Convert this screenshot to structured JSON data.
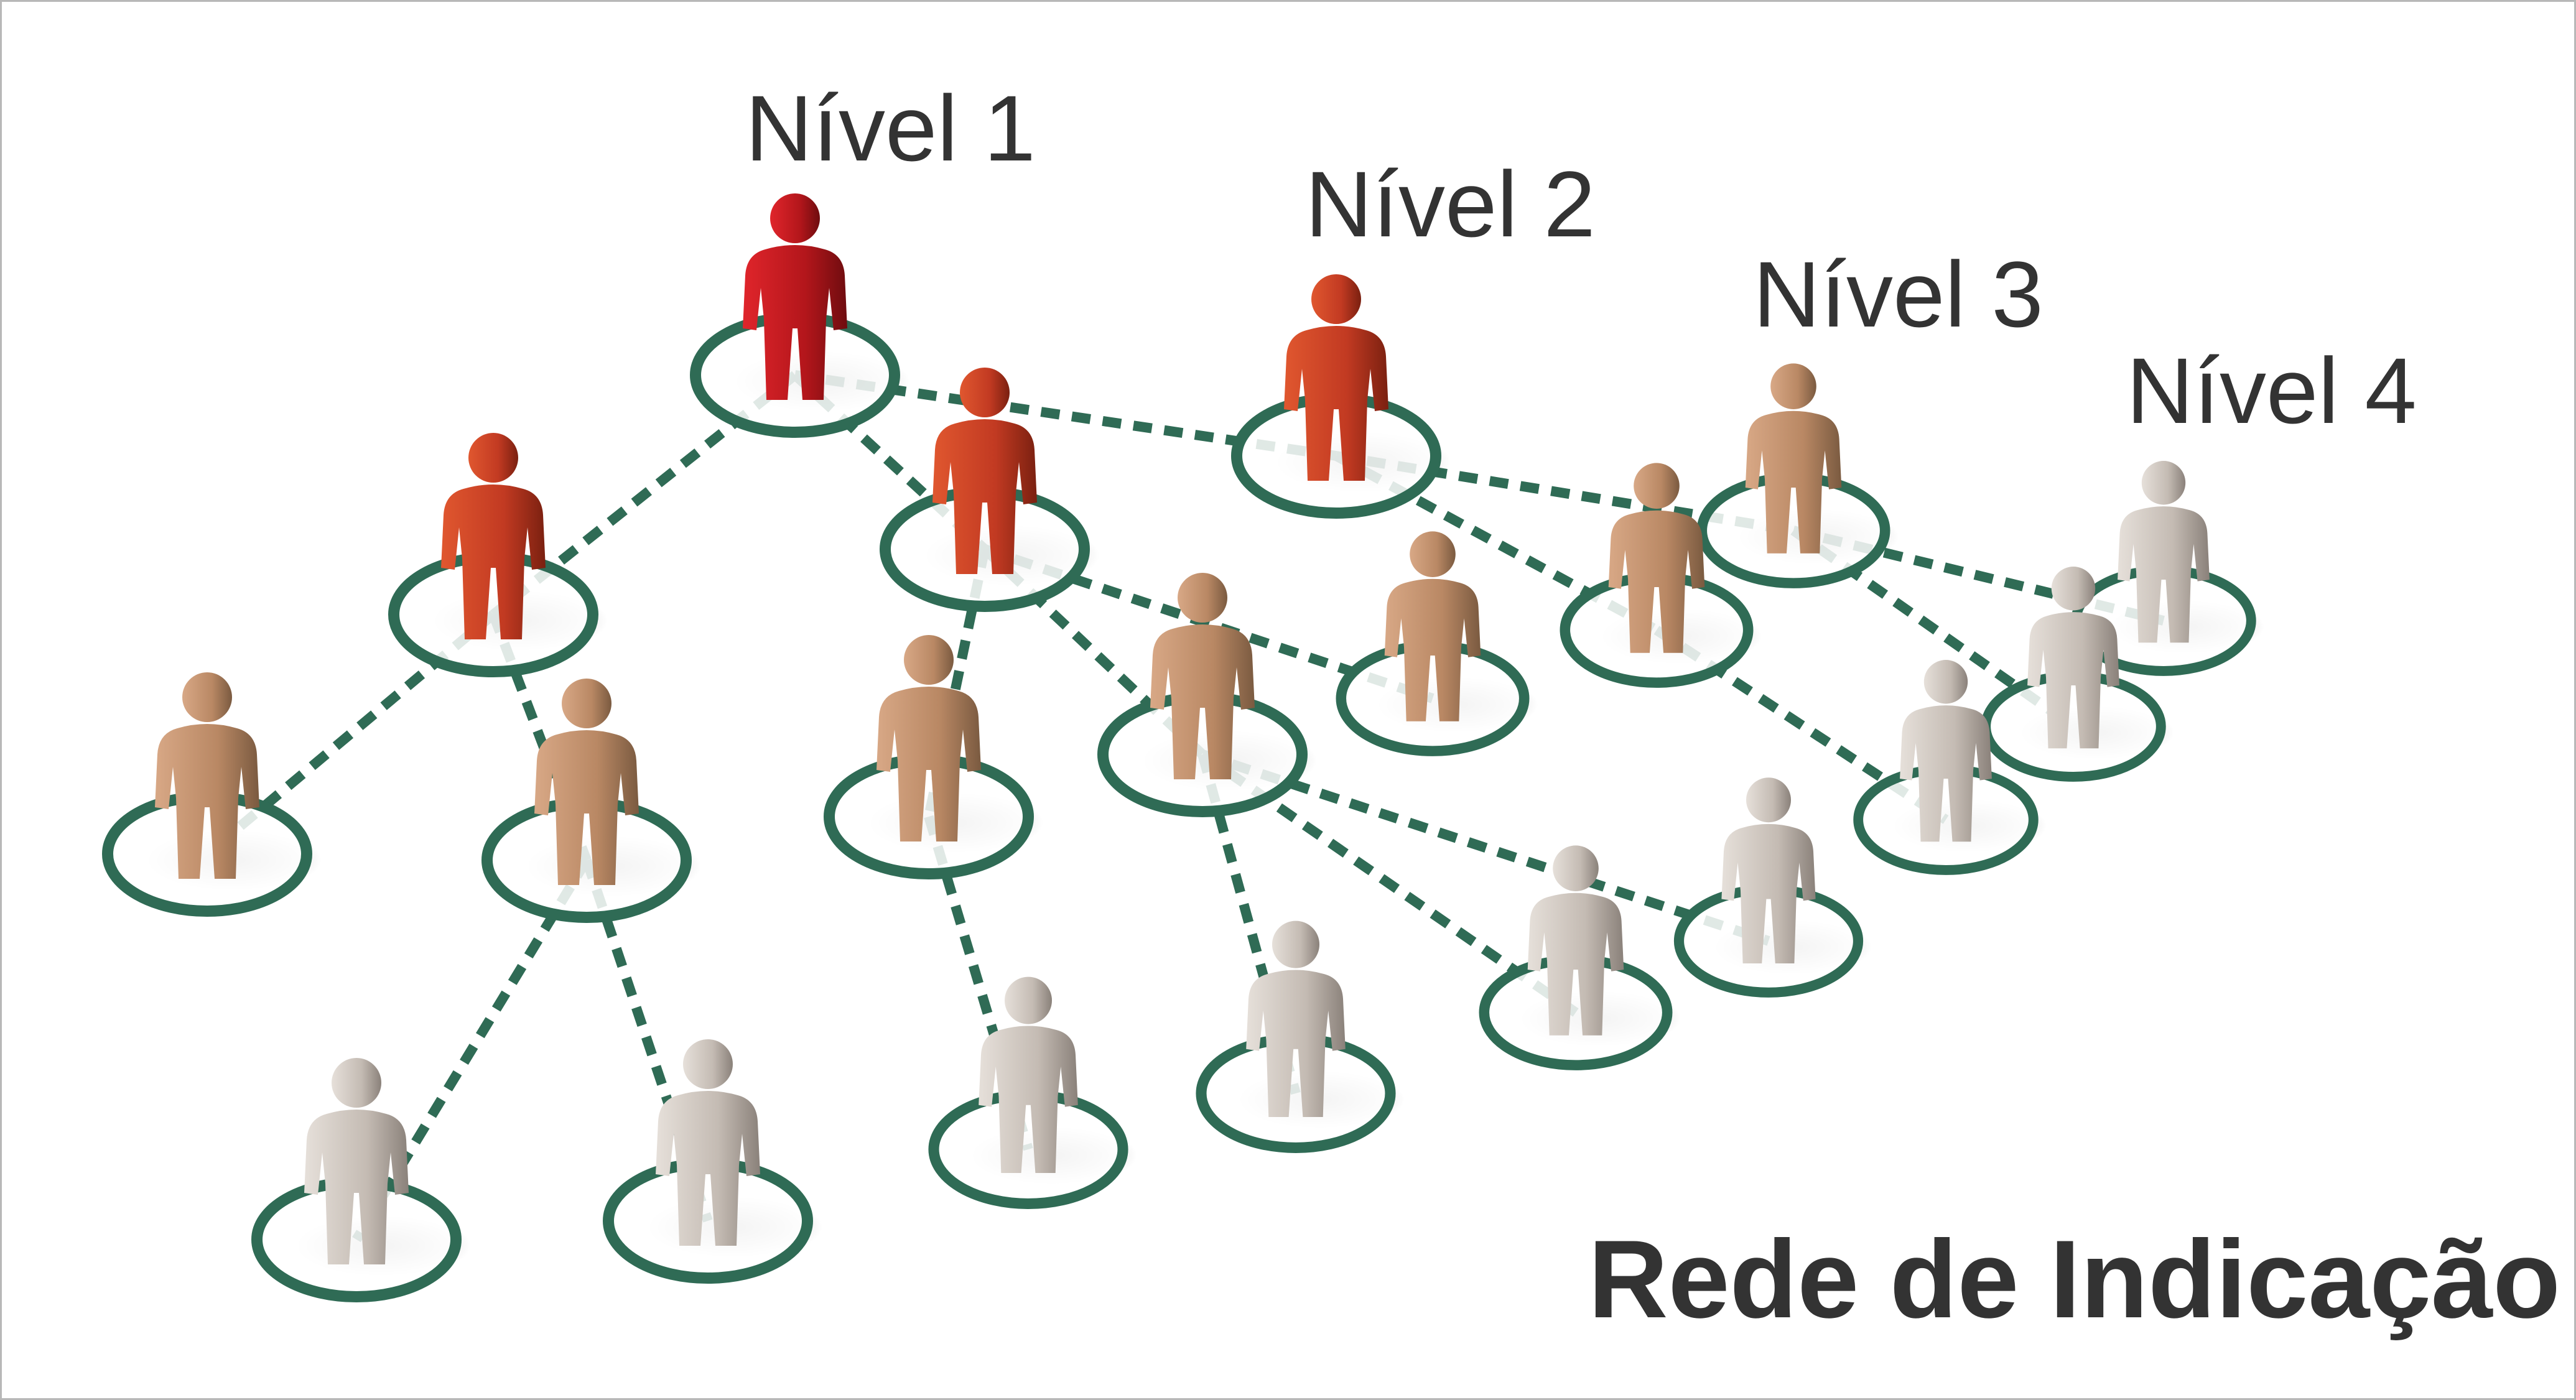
{
  "levels": [
    {
      "label": "Nível 1",
      "color": "#b3161b"
    },
    {
      "label": "Nível 2",
      "color": "#c23a22"
    },
    {
      "label": "Nível 3",
      "color": "#b98864"
    },
    {
      "label": "Nível 4",
      "color": "#c4bbb3"
    }
  ],
  "title": "Rede de Indicação",
  "ring_color": "#2f6b55",
  "link_color": "#2f6b55"
}
